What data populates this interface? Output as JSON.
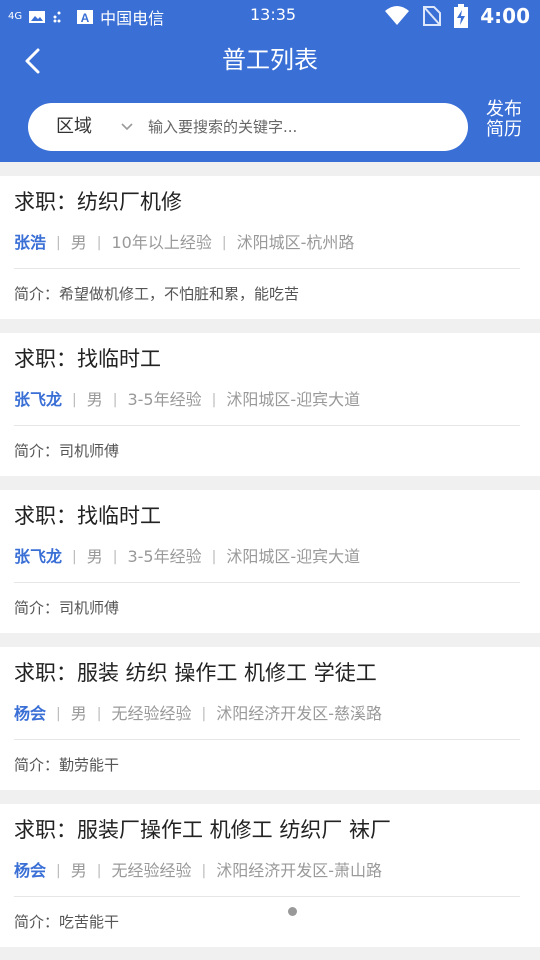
{
  "status_bar": {
    "glyph": "4G",
    "carrier": "中国电信",
    "time": "13:35",
    "battery_text": "4:00"
  },
  "header": {
    "title": "普工列表",
    "region_label": "区域",
    "search_placeholder": "输入要搜索的关键字...",
    "publish_line1": "发布",
    "publish_line2": "简历"
  },
  "colors": {
    "primary": "#3a6fd6",
    "background": "#f0f0f0"
  },
  "jobs": [
    {
      "title": "求职：纺织厂机修",
      "name": "张浩",
      "gender": "男",
      "experience": "10年以上经验",
      "location": "沭阳城区-杭州路",
      "intro": "简介：希望做机修工，不怕脏和累，能吃苦"
    },
    {
      "title": "求职：找临时工",
      "name": "张飞龙",
      "gender": "男",
      "experience": "3-5年经验",
      "location": "沭阳城区-迎宾大道",
      "intro": "简介：司机师傅"
    },
    {
      "title": "求职：找临时工",
      "name": "张飞龙",
      "gender": "男",
      "experience": "3-5年经验",
      "location": "沭阳城区-迎宾大道",
      "intro": "简介：司机师傅"
    },
    {
      "title": "求职：服装 纺织 操作工 机修工 学徒工",
      "name": "杨会",
      "gender": "男",
      "experience": "无经验经验",
      "location": "沭阳经济开发区-慈溪路",
      "intro": "简介：勤劳能干"
    },
    {
      "title": "求职：服装厂操作工 机修工 纺织厂 袜厂",
      "name": "杨会",
      "gender": "男",
      "experience": "无经验经验",
      "location": "沭阳经济开发区-萧山路",
      "intro": "简介：吃苦能干"
    }
  ]
}
